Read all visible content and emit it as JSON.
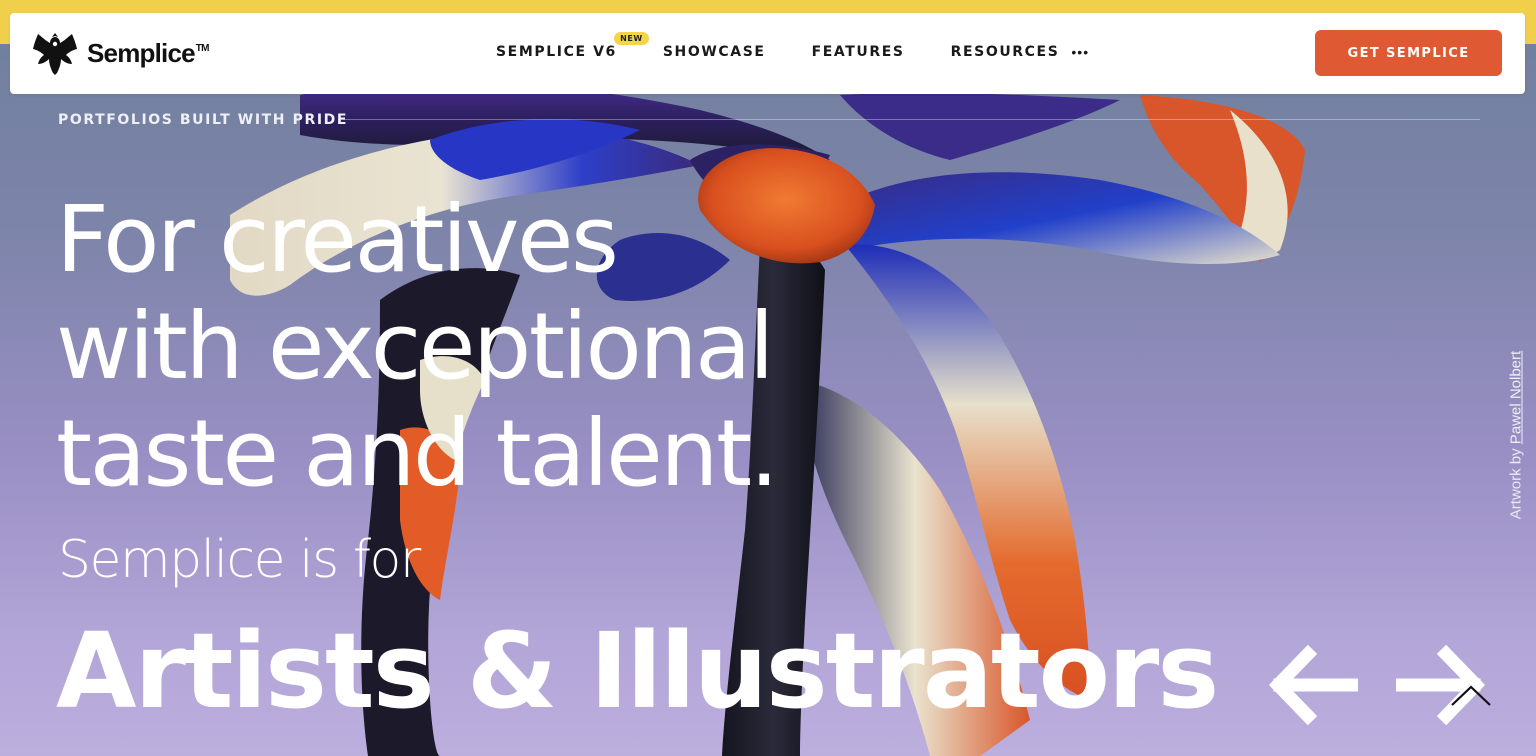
{
  "brand": {
    "name": "Semplice",
    "trademark": "TM"
  },
  "nav": {
    "items": [
      {
        "label": "SEMPLICE V6",
        "badge": "NEW"
      },
      {
        "label": "SHOWCASE"
      },
      {
        "label": "FEATURES"
      },
      {
        "label": "RESOURCES"
      }
    ],
    "more_dots": "•••",
    "cta_label": "GET SEMPLICE"
  },
  "hero": {
    "eyebrow": "PORTFOLIOS BUILT WITH PRIDE",
    "headline_lines": [
      "For creatives",
      "with exceptional",
      "taste and talent."
    ],
    "lead": "Semplice is for",
    "rotating_word": "Artists & Illustrators",
    "credit_prefix": "Artwork by ",
    "credit_name": "Pawel Nolbert"
  },
  "icons": {
    "logo": "eagle-crest-icon",
    "more": "more-dots-icon",
    "prev": "arrow-left-icon",
    "next": "arrow-right-icon",
    "scroll_top": "chevron-up-icon"
  },
  "colors": {
    "top_bar": "#f0cf4a",
    "badge": "#f5d547",
    "cta": "#df5a33",
    "background_top": "#6f7f9c",
    "background_bottom": "#bcaedd",
    "text_on_hero": "#ffffff"
  }
}
